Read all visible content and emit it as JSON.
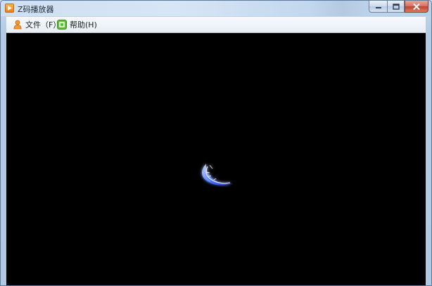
{
  "window": {
    "title": "Z码播放器",
    "controls": {
      "minimize": "minimize",
      "maximize": "maximize",
      "close": "close"
    }
  },
  "menu": {
    "items": [
      {
        "label": "文件（F）",
        "icon": "person-icon"
      },
      {
        "label": "帮助(H)",
        "icon": "help-icon"
      }
    ]
  },
  "player": {
    "background": "#000000",
    "state_indicator": "loading-spinner-icon",
    "accent": "#3f6dff"
  }
}
